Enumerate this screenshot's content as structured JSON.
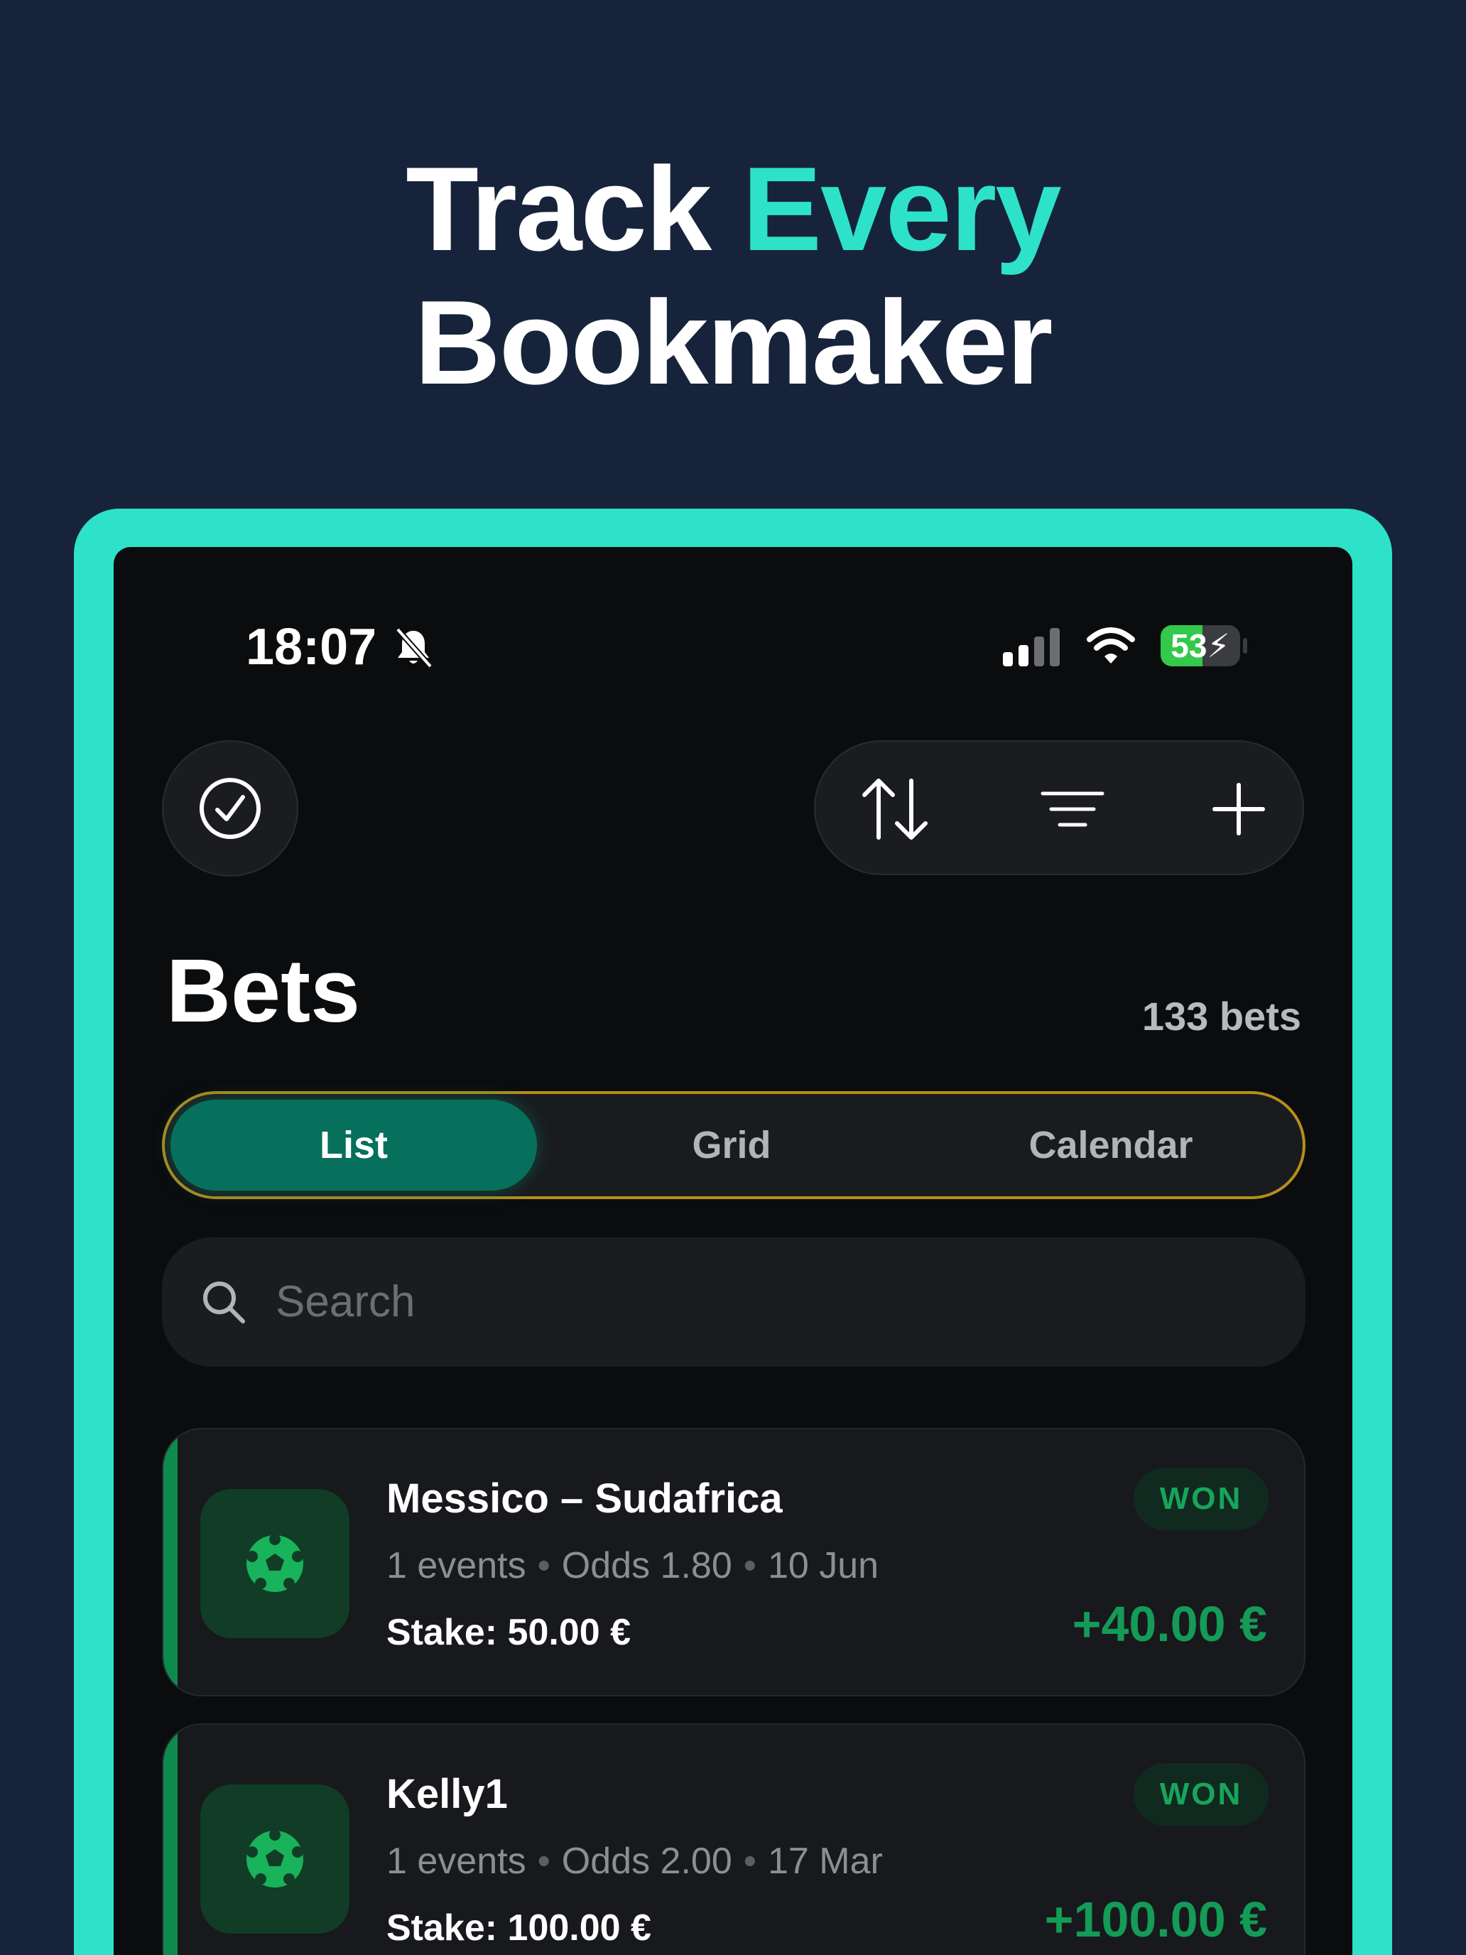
{
  "headline": {
    "part1": "Track ",
    "accent": "Every",
    "line2": "Bookmaker",
    "accent_color": "#2de2c8"
  },
  "status_bar": {
    "time": "18:07",
    "battery_level": 53,
    "battery_text": "53",
    "icons": [
      "bell-slash-icon",
      "signal-icon",
      "wifi-icon",
      "battery-charging-icon"
    ]
  },
  "toolbar": {
    "icons": [
      "checkmark-circle-icon",
      "sort-arrows-icon",
      "filter-lines-icon",
      "plus-icon"
    ]
  },
  "page": {
    "title": "Bets",
    "count": "133 bets"
  },
  "view_tabs": [
    {
      "label": "List",
      "active": true
    },
    {
      "label": "Grid",
      "active": false
    },
    {
      "label": "Calendar",
      "active": false
    }
  ],
  "search": {
    "placeholder": "Search",
    "value": ""
  },
  "bets": [
    {
      "name": "Messico – Sudafrica",
      "events": "1 events",
      "odds": "Odds 1.80",
      "date": "10 Jun",
      "stake": "Stake: 50.00 €",
      "status": "WON",
      "profit": "+40.00 €",
      "icon": "soccer-ball-icon"
    },
    {
      "name": "Kelly1",
      "events": "1 events",
      "odds": "Odds 2.00",
      "date": "17 Mar",
      "stake": "Stake: 100.00 €",
      "status": "WON",
      "profit": "+100.00 €",
      "icon": "soccer-ball-icon"
    }
  ],
  "colors": {
    "background": "#16233b",
    "frame": "#2de2c8",
    "active_tab": "#06705c",
    "won": "#17a55c",
    "segmented_border": "#b58f1c"
  }
}
